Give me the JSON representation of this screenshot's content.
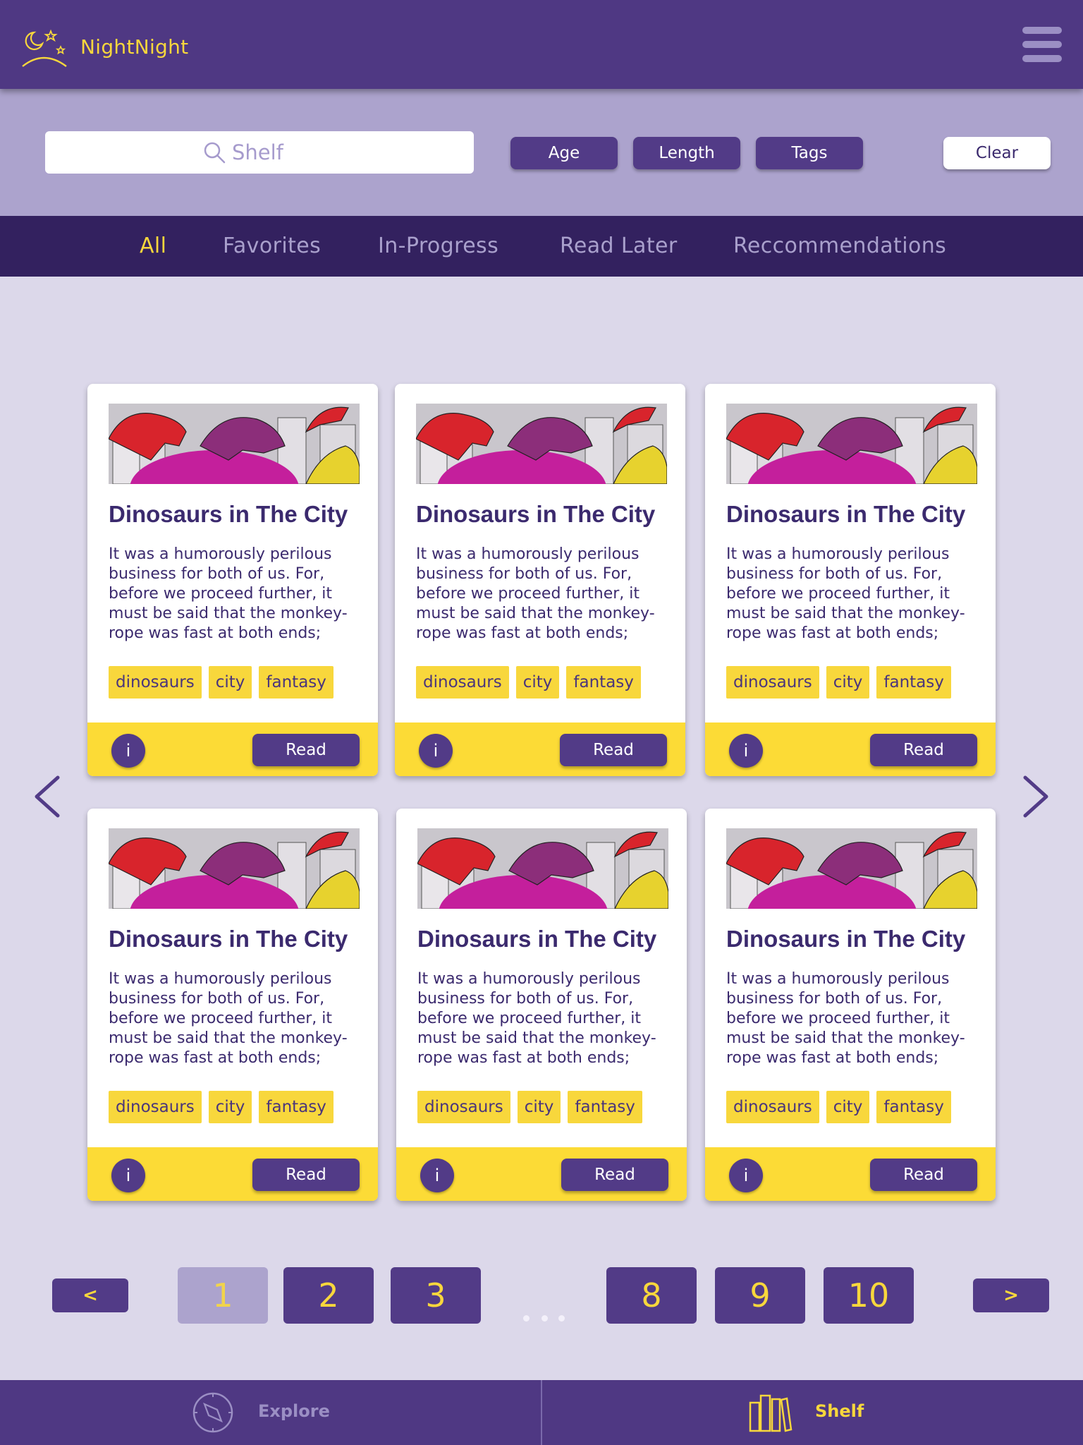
{
  "app": {
    "title": "NightNight",
    "menu_icon": "hamburger-menu-icon"
  },
  "filters": {
    "search_placeholder": "Shelf",
    "age_label": "Age",
    "length_label": "Length",
    "tags_label": "Tags",
    "clear_label": "Clear"
  },
  "tabs": [
    {
      "label": "All",
      "active": true
    },
    {
      "label": "Favorites",
      "active": false
    },
    {
      "label": "In-Progress",
      "active": false
    },
    {
      "label": "Read Later",
      "active": false
    },
    {
      "label": "Reccommendations",
      "active": false
    }
  ],
  "cards": [
    {
      "title": "Dinosaurs in The City",
      "description": "It was a humorously perilous business for both of us. For, before we proceed further, it must be said that the monkey-rope was fast at both ends;",
      "tags": [
        "dinosaurs",
        "city",
        "fantasy"
      ],
      "info_label": "i",
      "read_label": "Read"
    },
    {
      "title": "Dinosaurs in The City",
      "description": "It was a humorously perilous business for both of us. For, before we proceed further, it must be said that the monkey-rope was fast at both ends;",
      "tags": [
        "dinosaurs",
        "city",
        "fantasy"
      ],
      "info_label": "i",
      "read_label": "Read"
    },
    {
      "title": "Dinosaurs in The City",
      "description": "It was a humorously perilous business for both of us. For, before we proceed further, it must be said that the monkey-rope was fast at both ends;",
      "tags": [
        "dinosaurs",
        "city",
        "fantasy"
      ],
      "info_label": "i",
      "read_label": "Read"
    },
    {
      "title": "Dinosaurs in The City",
      "description": "It was a humorously perilous business for both of us. For, before we proceed further, it must be said that the monkey-rope was fast at both ends;",
      "tags": [
        "dinosaurs",
        "city",
        "fantasy"
      ],
      "info_label": "i",
      "read_label": "Read"
    },
    {
      "title": "Dinosaurs in The City",
      "description": "It was a humorously perilous business for both of us. For, before we proceed further, it must be said that the monkey-rope was fast at both ends;",
      "tags": [
        "dinosaurs",
        "city",
        "fantasy"
      ],
      "info_label": "i",
      "read_label": "Read"
    },
    {
      "title": "Dinosaurs in The City",
      "description": "It was a humorously perilous business for both of us. For, before we proceed further, it must be said that the monkey-rope was fast at both ends;",
      "tags": [
        "dinosaurs",
        "city",
        "fantasy"
      ],
      "info_label": "i",
      "read_label": "Read"
    }
  ],
  "pagination": {
    "prev_label": "<",
    "next_label": ">",
    "pages": [
      "1",
      "2",
      "3",
      "8",
      "9",
      "10"
    ],
    "current": "1"
  },
  "bottom_nav": {
    "explore_label": "Explore",
    "explore_icon": "compass-icon",
    "shelf_label": "Shelf",
    "shelf_icon": "bookshelf-icon",
    "active": "Shelf"
  },
  "colors": {
    "header": "#4f3883",
    "filter_bar": "#aca3cd",
    "tab_bar": "#33215f",
    "background": "#dcd8ea",
    "accent": "#f8d73c",
    "button": "#523b87",
    "inactive_text": "#a9a0cc"
  }
}
